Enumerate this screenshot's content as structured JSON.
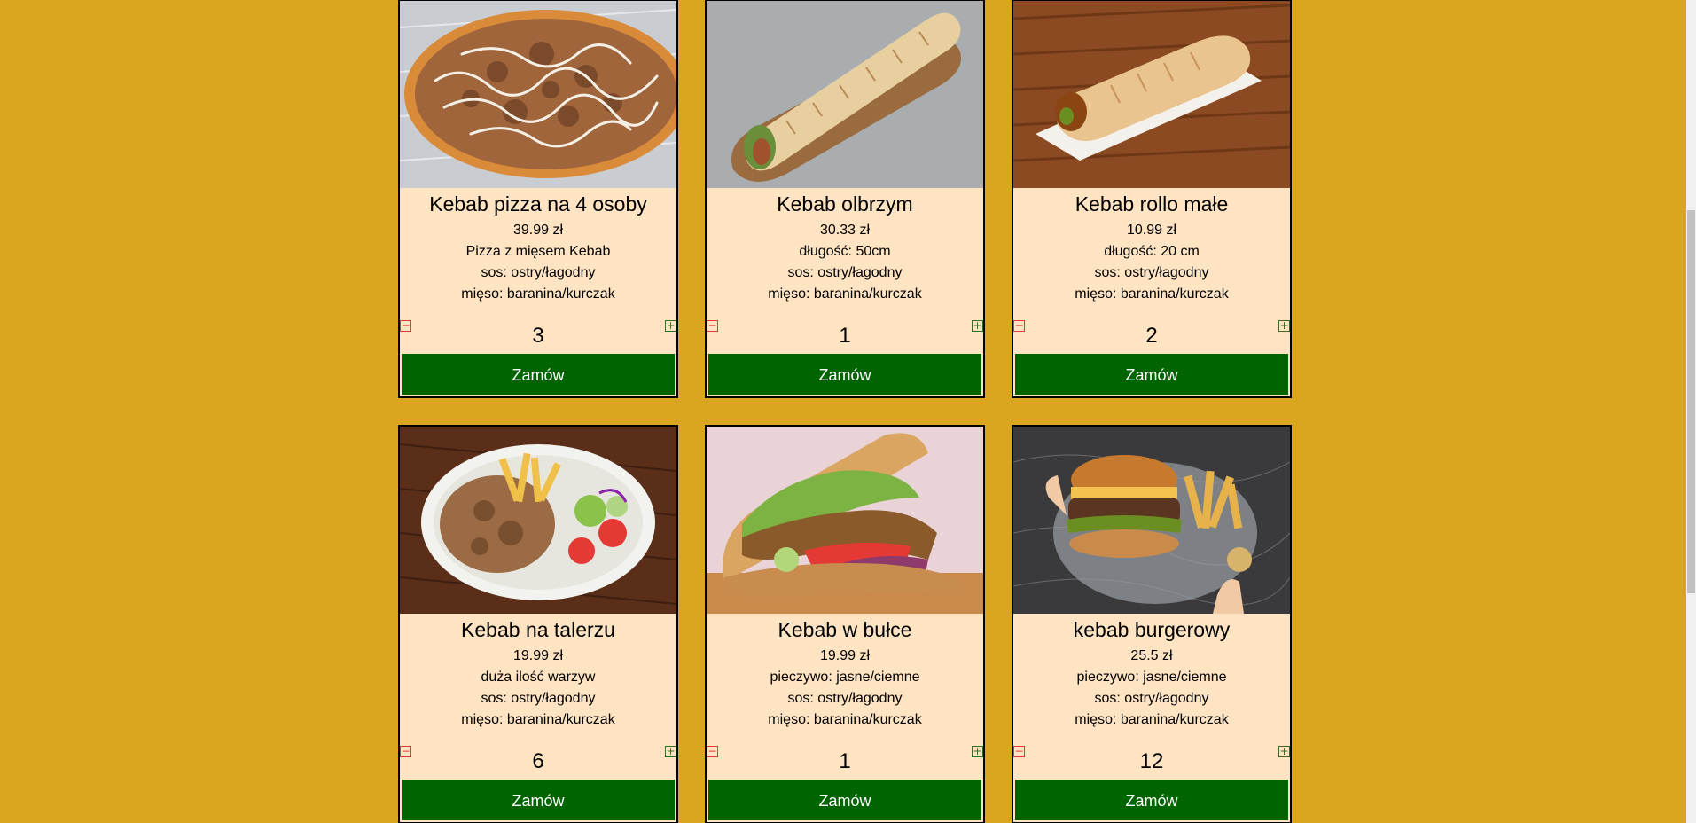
{
  "products": [
    {
      "name": "Kebab pizza na 4 osoby",
      "price": "39.99 zł",
      "details": [
        "Pizza z mięsem Kebab",
        "sos: ostry/łagodny",
        "mięso: baranina/kurczak"
      ],
      "quantity": "3",
      "order_label": "Zamów",
      "image_icon": "pizza-photo"
    },
    {
      "name": "Kebab olbrzym",
      "price": "30.33 zł",
      "details": [
        "długość: 50cm",
        "sos: ostry/łagodny",
        "mięso: baranina/kurczak"
      ],
      "quantity": "1",
      "order_label": "Zamów",
      "image_icon": "wrap-on-board-photo"
    },
    {
      "name": "Kebab rollo małe",
      "price": "10.99 zł",
      "details": [
        "długość: 20 cm",
        "sos: ostry/łagodny",
        "mięso: baranina/kurczak"
      ],
      "quantity": "2",
      "order_label": "Zamów",
      "image_icon": "wrap-on-plate-photo"
    },
    {
      "name": "Kebab na talerzu",
      "price": "19.99 zł",
      "details": [
        "duża ilość warzyw",
        "sos: ostry/łagodny",
        "mięso: baranina/kurczak"
      ],
      "quantity": "6",
      "order_label": "Zamów",
      "image_icon": "kebab-plate-photo"
    },
    {
      "name": "Kebab w bułce",
      "price": "19.99 zł",
      "details": [
        "pieczywo: jasne/ciemne",
        "sos: ostry/łagodny",
        "mięso: baranina/kurczak"
      ],
      "quantity": "1",
      "order_label": "Zamów",
      "image_icon": "kebab-bun-photo"
    },
    {
      "name": "kebab burgerowy",
      "price": "25.5 zł",
      "details": [
        "pieczywo: jasne/ciemne",
        "sos: ostry/łagodny",
        "mięso: baranina/kurczak"
      ],
      "quantity": "12",
      "order_label": "Zamów",
      "image_icon": "burger-photo"
    }
  ],
  "controls": {
    "minus_symbol": "−",
    "plus_symbol": "+"
  },
  "colors": {
    "page_background": "#DAA520",
    "card_background": "#FFE4C4",
    "order_button": "#006400",
    "minus_accent": "#E53935",
    "plus_accent": "#3B6B22"
  }
}
